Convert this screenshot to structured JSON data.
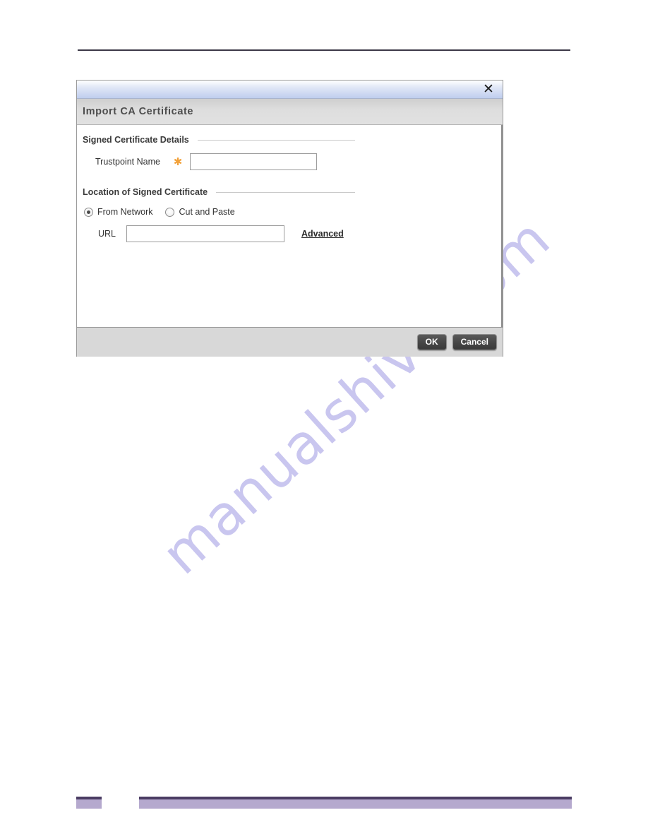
{
  "dialog": {
    "titlebar": {
      "close_icon": "close-icon",
      "close_glyph": "✕"
    },
    "title": "Import CA Certificate",
    "sections": [
      {
        "heading": "Signed Certificate Details",
        "fields": [
          {
            "label": "Trustpoint Name",
            "required_marker": "✱",
            "value": "",
            "placeholder": ""
          }
        ]
      },
      {
        "heading": "Location of Signed Certificate",
        "radios": [
          {
            "label": "From Network",
            "checked": true
          },
          {
            "label": "Cut and Paste",
            "checked": false
          }
        ],
        "fields": [
          {
            "label": "URL",
            "value": "",
            "placeholder": ""
          }
        ],
        "link": "Advanced"
      }
    ],
    "footer": {
      "ok_label": "OK",
      "cancel_label": "Cancel"
    }
  },
  "page": {
    "watermark": "manualshive.com"
  },
  "colors": {
    "titlebar_blue": "#bfcdee",
    "header_gray": "#dedede",
    "required_orange": "#f2a13a",
    "button_dark": "#474747",
    "footer_purple_dark": "#4b3d63",
    "footer_purple_light": "#b5a9ce",
    "watermark_lavender": "#c9c6ef"
  }
}
